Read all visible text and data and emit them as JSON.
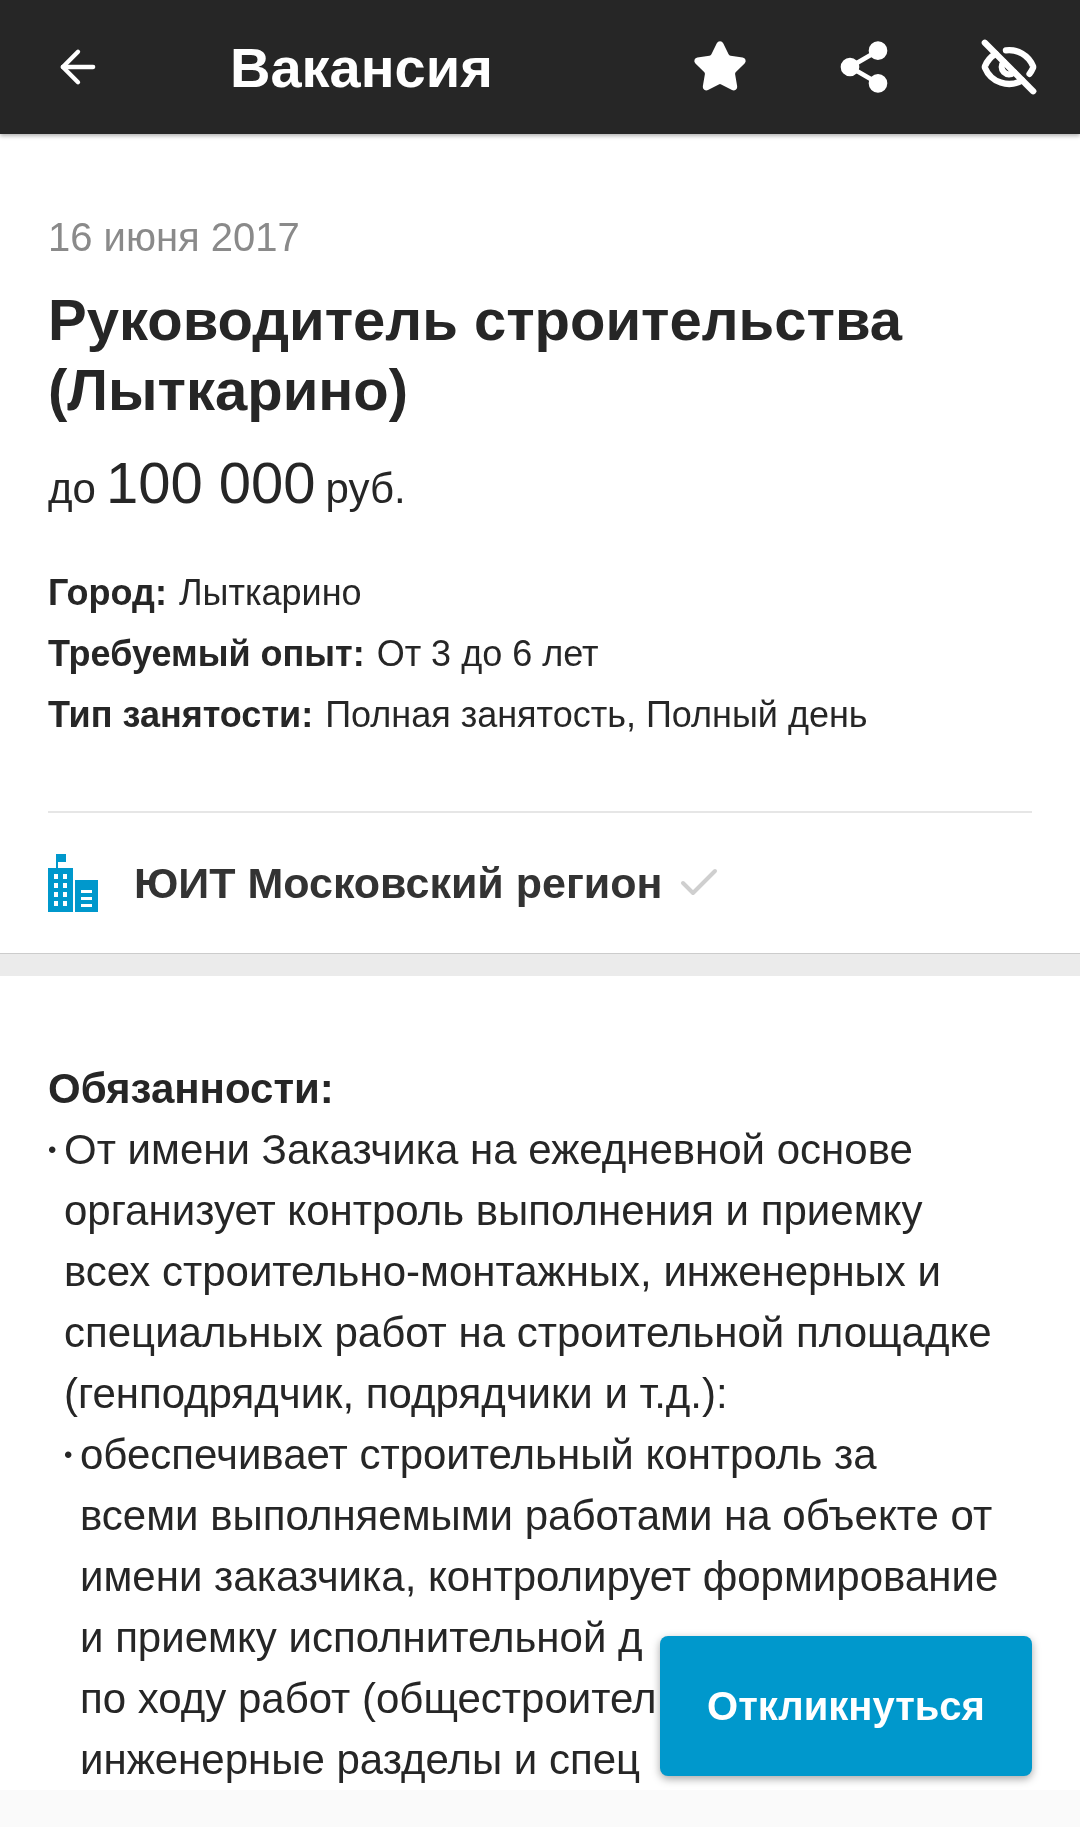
{
  "app_bar": {
    "title": "Вакансия"
  },
  "vacancy": {
    "date": "16 июня 2017",
    "title_lines": [
      "Руководитель строительства",
      "(Лыткарино)"
    ],
    "salary": {
      "prefix": "до",
      "amount": "100 000",
      "currency": "руб."
    },
    "details": [
      {
        "label": "Город:",
        "value": "Лыткарино"
      },
      {
        "label": "Требуемый опыт:",
        "value": "От 3 до 6 лет"
      },
      {
        "label": "Тип занятости:",
        "value": "Полная занятость, Полный день"
      }
    ],
    "company": {
      "name": "ЮИТ Московский регион"
    }
  },
  "description": {
    "heading": "Обязанности:",
    "items": [
      {
        "bullet": "•",
        "kind": "item",
        "lines": [
          "От имени Заказчика на ежедневной основе",
          "организует контроль выполнения и приемку",
          "всех строительно-монтажных, инженерных и",
          "специальных работ на строительной площадке",
          "(генподрядчик, подрядчики и т.д.):"
        ]
      },
      {
        "bullet": "•",
        "kind": "subitem",
        "lines": [
          "обеспечивает строительный контроль за",
          "всеми выполняемыми работами на объекте от",
          "имени заказчика, контролирует формирование",
          "и приемку исполнительной д",
          "по ходу работ (общестроител",
          "инженерные разделы и спец"
        ]
      }
    ]
  },
  "apply_button": {
    "label": "Откликнуться"
  }
}
